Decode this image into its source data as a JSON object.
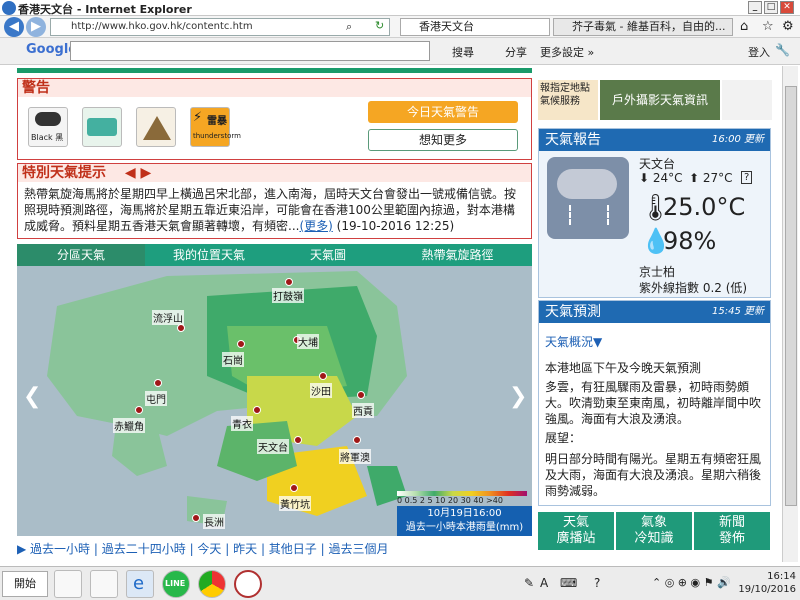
{
  "window": {
    "title": "香港天文台 - Internet Explorer",
    "buttons": [
      "_",
      "□",
      "✕"
    ]
  },
  "addressbar": {
    "url": "http://www.hko.gov.hk/contentc.htm",
    "tabs": [
      {
        "label": "香港天文台"
      },
      {
        "label": "芥子毒氣 - 維基百科，自由的..."
      }
    ]
  },
  "google_toolbar": {
    "logo": "Google",
    "search_label": "搜尋",
    "share_label": "分享",
    "settings_label": "更多設定 »",
    "signin_label": "登入"
  },
  "warning": {
    "title": "警告",
    "black_rain_label": "Black 黑",
    "thunderstorm_label": "雷暴",
    "thunderstorm_sub": "thunderstorm",
    "today_button": "今日天氣警告",
    "more_button": "想知更多"
  },
  "special_tip": {
    "title": "特別天氣提示",
    "body": "熱帶氣旋海馬將於星期四早上橫過呂宋北部，進入南海，屆時天文台會發出一號戒備信號。按照現時預測路徑，海馬將於星期五靠近東沿岸，可能會在香港100公里範圍內掠過，對本港構成威脅。預料星期五香港天氣會顯著轉壞，有頻密...",
    "more_link": "(更多)",
    "timestamp": "(19-10-2016 12:25)"
  },
  "map_tabs": [
    "分區天氣",
    "我的位置天氣",
    "天氣圖",
    "熱帶氣旋路徑"
  ],
  "map": {
    "places": [
      "打鼓嶺",
      "流浮山",
      "大埔",
      "石崗",
      "沙田",
      "屯門",
      "西貢",
      "赤鱲角",
      "青衣",
      "天文台",
      "將軍澳",
      "黃竹坑",
      "長洲"
    ],
    "legend": "0 0.5 2 5 10 20 30 40 >40",
    "date": "10月19日16:00",
    "caption": "過去一小時本港雨量(mm)"
  },
  "bottom_nav": [
    "過去一小時",
    "過去二十四小時",
    "今天",
    "昨天",
    "其他日子",
    "過去三個月"
  ],
  "banners": [
    "報指定地點",
    "氣候服務",
    "戶外攝影天氣資訊"
  ],
  "weather_report": {
    "title": "天氣報告",
    "time": "16:00 更新",
    "station": "天文台",
    "min_temp": "24°C",
    "max_temp": "27°C",
    "temperature": "25.0°C",
    "humidity": "98%",
    "uv_place": "京士柏",
    "uv": "紫外線指數 0.2 (低)"
  },
  "forecast": {
    "title": "天氣預測",
    "time": "15:45 更新",
    "summary_link": "天氣概況▼",
    "heading": "本港地區下午及今晚天氣預測",
    "text1": "多雲，有狂風驟雨及雷暴，初時雨勢頗大。吹清勁東至東南風，初時離岸間中吹強風。海面有大浪及湧浪。",
    "outlook_label": "展望：",
    "text2": "明日部分時間有陽光。星期五有頻密狂風及大雨，海面有大浪及湧浪。星期六稍後雨勢減弱。"
  },
  "bottom_buttons": [
    {
      "line1": "天氣",
      "line2": "廣播站"
    },
    {
      "line1": "氣象",
      "line2": "冷知識"
    },
    {
      "line1": "新聞",
      "line2": "發佈"
    }
  ],
  "taskbar": {
    "start": "開始",
    "line_label": "LINE",
    "time": "16:14",
    "date": "19/10/2016"
  }
}
